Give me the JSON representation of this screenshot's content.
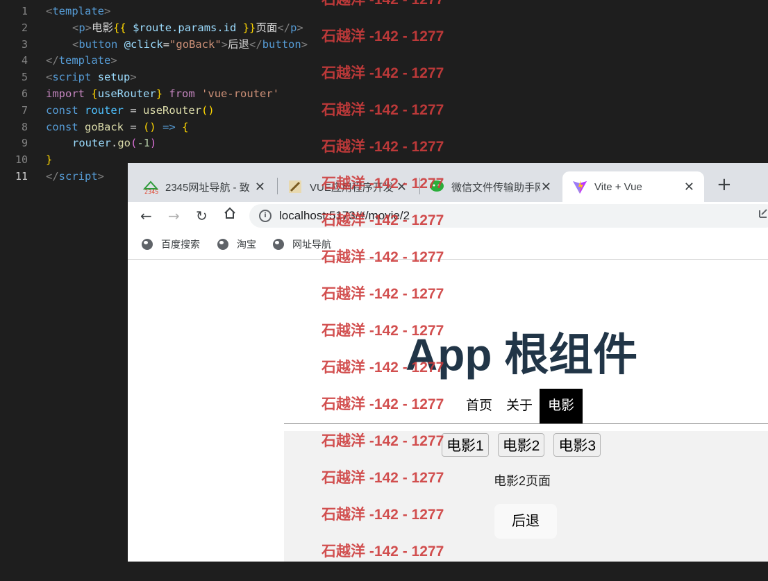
{
  "editor": {
    "line_numbers": [
      "1",
      "2",
      "3",
      "4",
      "5",
      "6",
      "7",
      "8",
      "9",
      "10",
      "11"
    ],
    "active_line": "11",
    "tokens": {
      "template": "template",
      "p": "p",
      "p_text": "电影",
      "tpl_open": "{{",
      "route_expr": "$route.params.id",
      "tpl_close": "}}",
      "page_text": "页面",
      "button": "button",
      "click_attr": "@click",
      "go_back_str": "\"goBack\"",
      "back_text": "后退",
      "script": "script",
      "setup": "setup",
      "import": "import",
      "use_router": "useRouter",
      "from": "from",
      "vue_router_str": "'vue-router'",
      "const": "const",
      "router": "router",
      "go_back": "goBack",
      "arrow": "=>",
      "go": "go",
      "minus_one": "-1"
    }
  },
  "browser": {
    "tabs": [
      {
        "label": "2345网址导航 - 致",
        "icon": "2345-logo-icon"
      },
      {
        "label": "VUE应用程序开发",
        "icon": "pencil-icon"
      },
      {
        "label": "微信文件传输助手网",
        "icon": "wechat-icon"
      },
      {
        "label": "Vite + Vue",
        "icon": "vite-logo-icon",
        "active": true
      }
    ],
    "address": "localhost:5173/#/movie/2",
    "bookmarks": [
      "百度搜索",
      "淘宝",
      "网址导航"
    ]
  },
  "app": {
    "title": "App 根组件",
    "nav": [
      "首页",
      "关于",
      "电影"
    ],
    "active_nav": "电影",
    "movie_buttons": [
      "电影1",
      "电影2",
      "电影3"
    ],
    "movie_page_text": "电影2页面",
    "back_button": "后退"
  },
  "watermark": {
    "text": "石越洋 -142 - 1277",
    "color": "#cd3c3c"
  }
}
